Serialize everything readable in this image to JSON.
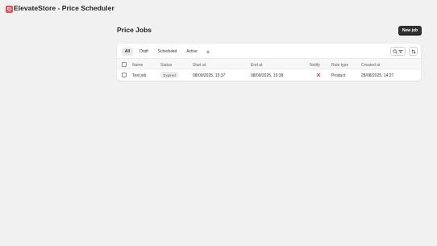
{
  "app": {
    "title": "ElevateStore - Price Scheduler"
  },
  "page": {
    "title": "Price Jobs",
    "new_job_label": "New job"
  },
  "tabs": [
    "All",
    "Draft",
    "Scheduled",
    "Active"
  ],
  "tab_add_label": "+",
  "table": {
    "columns": [
      "Name",
      "Status",
      "Start at",
      "End at",
      "Notify",
      "Rule type",
      "Created at"
    ],
    "rows": [
      {
        "name": "Test job",
        "status": "Expired",
        "start_at": "08/09/2025, 15:37",
        "end_at": "08/09/2025, 15:39",
        "notify": "no",
        "rule_type": "Product",
        "created_at": "28/08/2025, 14:27"
      }
    ]
  },
  "colors": {
    "brand": "#e0555f",
    "primary_button": "#303030",
    "notify_false": "#e22c38"
  },
  "icons": {
    "logo": "tag-icon",
    "search": "search-icon",
    "filter": "filter-icon",
    "sort": "sort-icon",
    "notify_false": "x-icon"
  }
}
